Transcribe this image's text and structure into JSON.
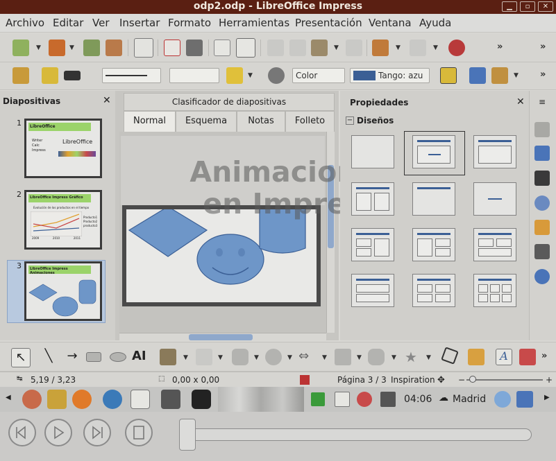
{
  "window": {
    "title": "odp2.odp - LibreOffice Impress"
  },
  "menu": [
    "Archivo",
    "Editar",
    "Ver",
    "Insertar",
    "Formato",
    "Herramientas",
    "Presentación",
    "Ventana",
    "Ayuda"
  ],
  "format_toolbar": {
    "color_mode": "Color",
    "color_name": "Tango: azu"
  },
  "slides_panel": {
    "title": "Diapositivas",
    "slides": [
      {
        "number": "1",
        "heading": "LibreOffice",
        "logo_text": "LibreOffice",
        "bullets": [
          "Writer",
          "Calc",
          "Impress"
        ]
      },
      {
        "number": "2",
        "heading": "LibreOffice Impress Gráfico",
        "chart_caption": "Evolución de los productos en el tiempo",
        "legend": [
          "Producto1",
          "Producto2",
          "producto3"
        ],
        "axis": [
          "2009",
          "2010",
          "2011"
        ]
      },
      {
        "number": "3",
        "heading": "LibreOffice Impress Animaciones"
      }
    ]
  },
  "editor": {
    "sorter_tab": "Clasificador de diapositivas",
    "tabs": [
      "Normal",
      "Esquema",
      "Notas",
      "Folleto"
    ],
    "active_tab": "Normal"
  },
  "overlay": {
    "line1": "Animaciones",
    "line2": "en Impress"
  },
  "properties": {
    "title": "Propiedades",
    "section": "Diseños"
  },
  "status": {
    "position": "5,19 / 3,23",
    "size": "0,00 x 0,00",
    "page": "Página 3 / 3",
    "design": "Inspiration"
  },
  "taskbar": {
    "clock": "04:06",
    "city": "Madrid"
  },
  "colors": {
    "titlebar": "#5a1f12",
    "accent": "#3b5f95",
    "selection": "#b8c9df"
  }
}
